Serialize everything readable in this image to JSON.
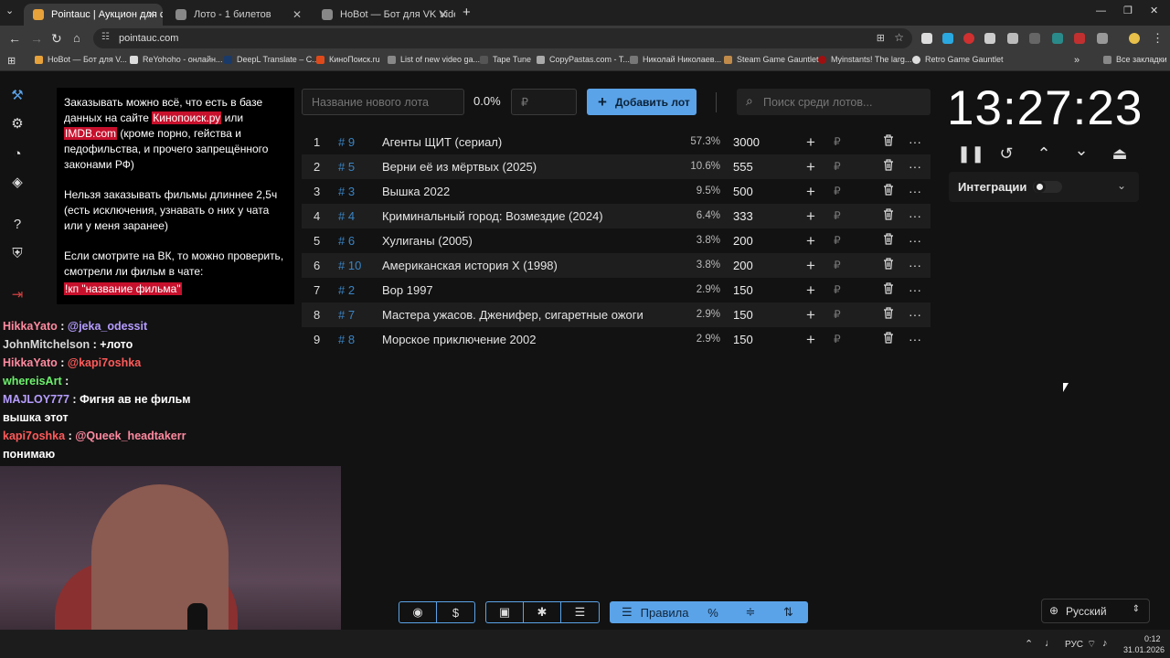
{
  "browser": {
    "tabs": [
      {
        "label": "Pointauc | Аукцион для стрима",
        "active": true,
        "color": "#e8a23a"
      },
      {
        "label": "Лото - 1 билетов",
        "active": false,
        "color": "#888888"
      },
      {
        "label": "HoBot — Бот для VK Video Live",
        "active": false,
        "color": "#888888"
      }
    ],
    "new_tab": "+",
    "url": "pointauc.com",
    "bookmarks": [
      "HoBot — Бот для V...",
      "ReYohoho - онлайн...",
      "DeepL Translate – C...",
      "КиноПоиск.ru",
      "List of new video ga...",
      "Tape Tune",
      "CopyPastas.com - T...",
      "Николай Николаев...",
      "Steam Game Gauntlet",
      "Myinstants! The larg...",
      "Retro Game Gauntlet"
    ],
    "all_bookmarks": "Все закладки"
  },
  "info": {
    "p1_before": "Заказывать можно всё, что есть в базе данных на сайте ",
    "p1_link1": "Кинопоиск.ру",
    "p1_mid": " или ",
    "p1_link2": "IMDB.com",
    "p1_after": " (кроме порно, гейства и педофильства, и прочего запрещённого законами РФ)",
    "p2": "Нельзя заказывать фильмы длиннее 2,5ч (есть исключения, узнавать о них у чата или у меня заранее)",
    "p3": "Если смотрите на ВК, то можно проверить, смотрели ли фильм в чате:",
    "command": "!кп \"название фильма\""
  },
  "chat": [
    {
      "user": "HikkaYato",
      "color": "#ff8aa0",
      "msg": "@jeka_odessit",
      "msg_color": "#b59cff"
    },
    {
      "user": "JohnMitchelson",
      "color": "#d8d8d8",
      "msg": "+лото",
      "msg_color": "#ffffff"
    },
    {
      "user": "HikkaYato",
      "color": "#ff8aa0",
      "msg": "@kapi7oshka",
      "msg_color": "#ff5a5a"
    },
    {
      "user": "whereisArt",
      "color": "#6cf06c",
      "msg": "",
      "msg_color": "#ffffff"
    },
    {
      "user": "MAJLOY777",
      "color": "#b59cff",
      "msg": "Фигня ав не фильм",
      "msg_color": "#ffffff"
    },
    {
      "user": "",
      "color": "#ffffff",
      "msg": "вышка этот",
      "msg_color": "#ffffff"
    },
    {
      "user": "kapi7oshka",
      "color": "#ff5a5a",
      "msg": "@Queek_headtakerr",
      "msg_color": "#ff8aa0"
    },
    {
      "user": "",
      "color": "#ffffff",
      "msg": "понимаю",
      "msg_color": "#ffffff"
    }
  ],
  "toolbar": {
    "new_lot_placeholder": "Название нового лота",
    "percent": "0.0%",
    "amount_placeholder": "₽",
    "add_button": "Добавить лот",
    "search_placeholder": "Поиск среди лотов..."
  },
  "lots": [
    {
      "n": "1",
      "id": "# 9",
      "title": "Агенты ЩИТ (сериал)",
      "pct": "57.3%",
      "amount": "3000"
    },
    {
      "n": "2",
      "id": "# 5",
      "title": "Верни её из мёртвых (2025)",
      "pct": "10.6%",
      "amount": "555"
    },
    {
      "n": "3",
      "id": "# 3",
      "title": "Вышка 2022",
      "pct": "9.5%",
      "amount": "500"
    },
    {
      "n": "4",
      "id": "# 4",
      "title": "Криминальный город: Возмездие (2024)",
      "pct": "6.4%",
      "amount": "333"
    },
    {
      "n": "5",
      "id": "# 6",
      "title": "Хулиганы (2005)",
      "pct": "3.8%",
      "amount": "200"
    },
    {
      "n": "6",
      "id": "# 10",
      "title": "Американская история X (1998)",
      "pct": "3.8%",
      "amount": "200"
    },
    {
      "n": "7",
      "id": "# 2",
      "title": "Вор 1997",
      "pct": "2.9%",
      "amount": "150"
    },
    {
      "n": "8",
      "id": "# 7",
      "title": "Мастера ужасов. Дженифер, сигаретные ожоги",
      "pct": "2.9%",
      "amount": "150"
    },
    {
      "n": "9",
      "id": "# 8",
      "title": "Морское приключение 2002",
      "pct": "2.9%",
      "amount": "150"
    }
  ],
  "row_actions": {
    "plus": "+",
    "currency": "₽",
    "more": "···"
  },
  "timer": {
    "value": "13:27:23"
  },
  "integrations": {
    "label": "Интеграции",
    "enabled": false
  },
  "bottom": {
    "rules_label": "Правила",
    "language": "Русский"
  },
  "taskbar": {
    "lang": "РУС",
    "time": "0:12",
    "date": "31.01.2026"
  },
  "colors": {
    "accent": "#5ba3e8",
    "highlight": "#c7102c",
    "lot_id": "#3a84c4"
  }
}
